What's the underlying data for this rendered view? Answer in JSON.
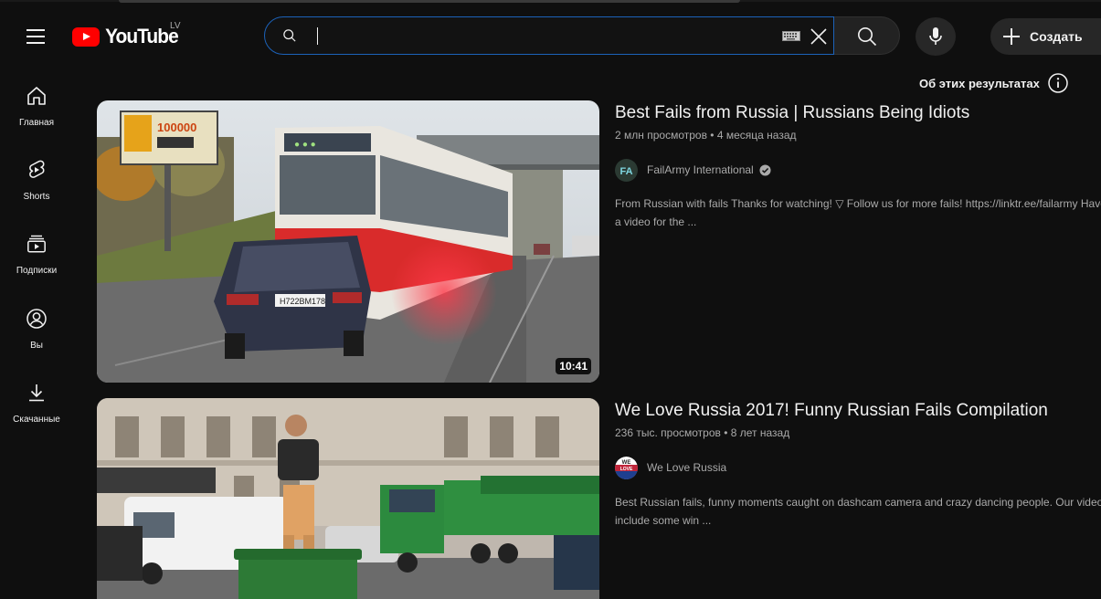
{
  "header": {
    "logo_text": "YouTube",
    "region_code": "LV",
    "search": {
      "value": "",
      "placeholder": ""
    },
    "create_label": "Создать"
  },
  "sidebar": {
    "items": [
      {
        "label": "Главная",
        "icon": "home-icon"
      },
      {
        "label": "Shorts",
        "icon": "shorts-icon"
      },
      {
        "label": "Подписки",
        "icon": "subscriptions-icon"
      },
      {
        "label": "Вы",
        "icon": "you-icon"
      },
      {
        "label": "Скачанные",
        "icon": "download-icon"
      }
    ]
  },
  "about_results": "Об этих результатах",
  "results": [
    {
      "title": "Best Fails from Russia | Russians Being Idiots",
      "views": "2 млн просмотров",
      "age": "4 месяца назад",
      "channel": "FailArmy International",
      "channel_avatar_text": "FA",
      "verified": true,
      "description_line1": "From Russian with fails Thanks for watching! ▽ Follow us for more fails! https://linktr.ee/failarmy Have",
      "description_line2": "a video for the ...",
      "duration": "10:41"
    },
    {
      "title": "We Love Russia 2017! Funny Russian Fails Compilation",
      "views": "236 тыс. просмотров",
      "age": "8 лет назад",
      "channel": "We Love Russia",
      "channel_avatar_text": "WE LOVE RUSSIA",
      "verified": false,
      "description_line1": "Best Russian fails, funny moments caught on dashcam camera and crazy dancing people. Our videos",
      "description_line2": "include some win ..."
    }
  ],
  "colors": {
    "background": "#0f0f0f",
    "search_focus_border": "#1c62b9",
    "logo_red": "#ff0000",
    "text_primary": "#f1f1f1",
    "text_secondary": "#aaaaaa"
  }
}
